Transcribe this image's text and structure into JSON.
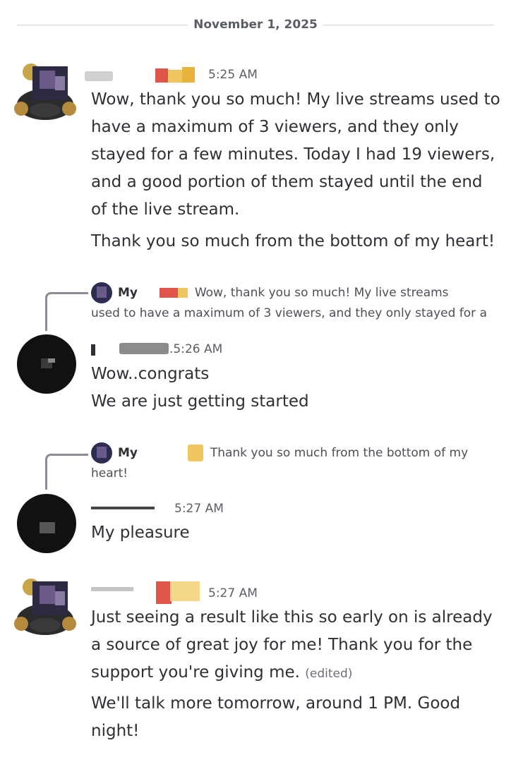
{
  "divider": {
    "date": "November 1, 2025"
  },
  "messages": [
    {
      "time": "5:25 AM",
      "paragraphs": [
        [
          "Wow, thank you so much! My live streams used to",
          "have a maximum of 3 viewers, and they only",
          "stayed for a few minutes. Today I had 19 viewers,",
          "and a good portion of them stayed until the end",
          "of the live stream."
        ],
        [
          "Thank you so much from the bottom of my heart!"
        ]
      ]
    },
    {
      "reply": {
        "name": "My",
        "lines": [
          "Wow, thank you so much! My live streams",
          "used to have a maximum of 3 viewers, and they only stayed for a"
        ]
      },
      "time": ".5:26 AM",
      "lines": [
        "Wow..congrats",
        "We are just getting started"
      ]
    },
    {
      "reply": {
        "name": "My",
        "lines": [
          "Thank you so much from the bottom of my",
          "heart!"
        ]
      },
      "time": "5:27 AM",
      "lines": [
        "My pleasure"
      ]
    },
    {
      "time": "5:27 AM",
      "paragraphs": [
        [
          "Just seeing a result like this so early on is already",
          "a source of great joy for me! Thank you for the",
          "support you're giving me."
        ],
        [
          "We'll talk more tomorrow, around 1 PM. Good",
          "night!"
        ]
      ],
      "edited": "(edited)"
    }
  ],
  "colors": {
    "text": "#2e3035",
    "muted": "#5c5e66",
    "divider": "#d4d6da"
  }
}
